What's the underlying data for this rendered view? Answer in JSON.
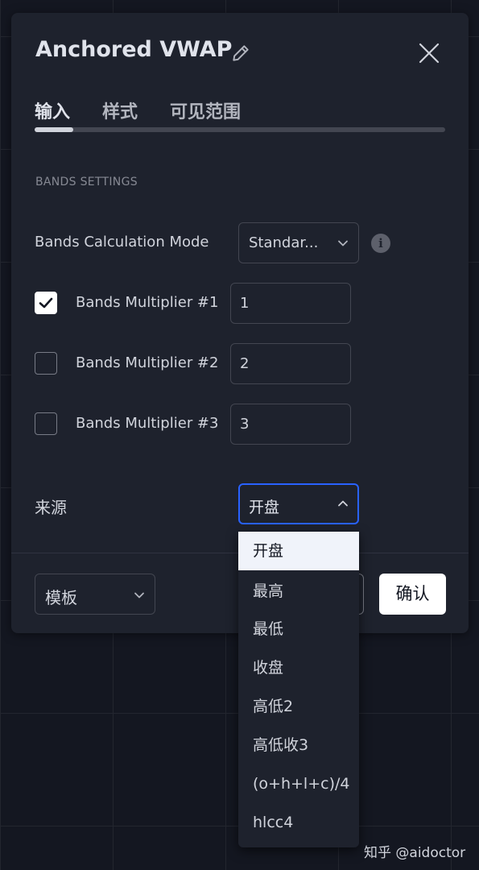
{
  "dialog": {
    "title": "Anchored VWAP",
    "tabs": [
      {
        "label": "输入",
        "active": true
      },
      {
        "label": "样式",
        "active": false
      },
      {
        "label": "可见范围",
        "active": false
      }
    ],
    "section_title": "BANDS SETTINGS",
    "bands_mode": {
      "label": "Bands Calculation Mode",
      "value": "Standar..."
    },
    "multipliers": [
      {
        "label": "Bands Multiplier #1",
        "checked": true,
        "value": "1"
      },
      {
        "label": "Bands Multiplier #2",
        "checked": false,
        "value": "2"
      },
      {
        "label": "Bands Multiplier #3",
        "checked": false,
        "value": "3"
      }
    ],
    "source": {
      "label": "来源",
      "value": "开盘",
      "options": [
        "开盘",
        "最高",
        "最低",
        "收盘",
        "高低2",
        "高低收3",
        "(o+h+l+c)/4",
        "hlcc4"
      ],
      "selected_index": 0
    },
    "footer": {
      "template_label": "模板",
      "ok_label": "确认"
    }
  },
  "watermark": "知乎 @aidoctor",
  "icons": {
    "edit": "pencil-icon",
    "close": "close-icon",
    "info": "info-icon",
    "check": "checkmark-icon",
    "chevron_down": "chevron-down-icon",
    "chevron_up": "chevron-up-icon"
  },
  "colors": {
    "background": "#141721",
    "dialog": "#1e222d",
    "accent_focus": "#2962ff",
    "primary_button": "#ffffff",
    "selected_option": "#f0f3fa"
  }
}
